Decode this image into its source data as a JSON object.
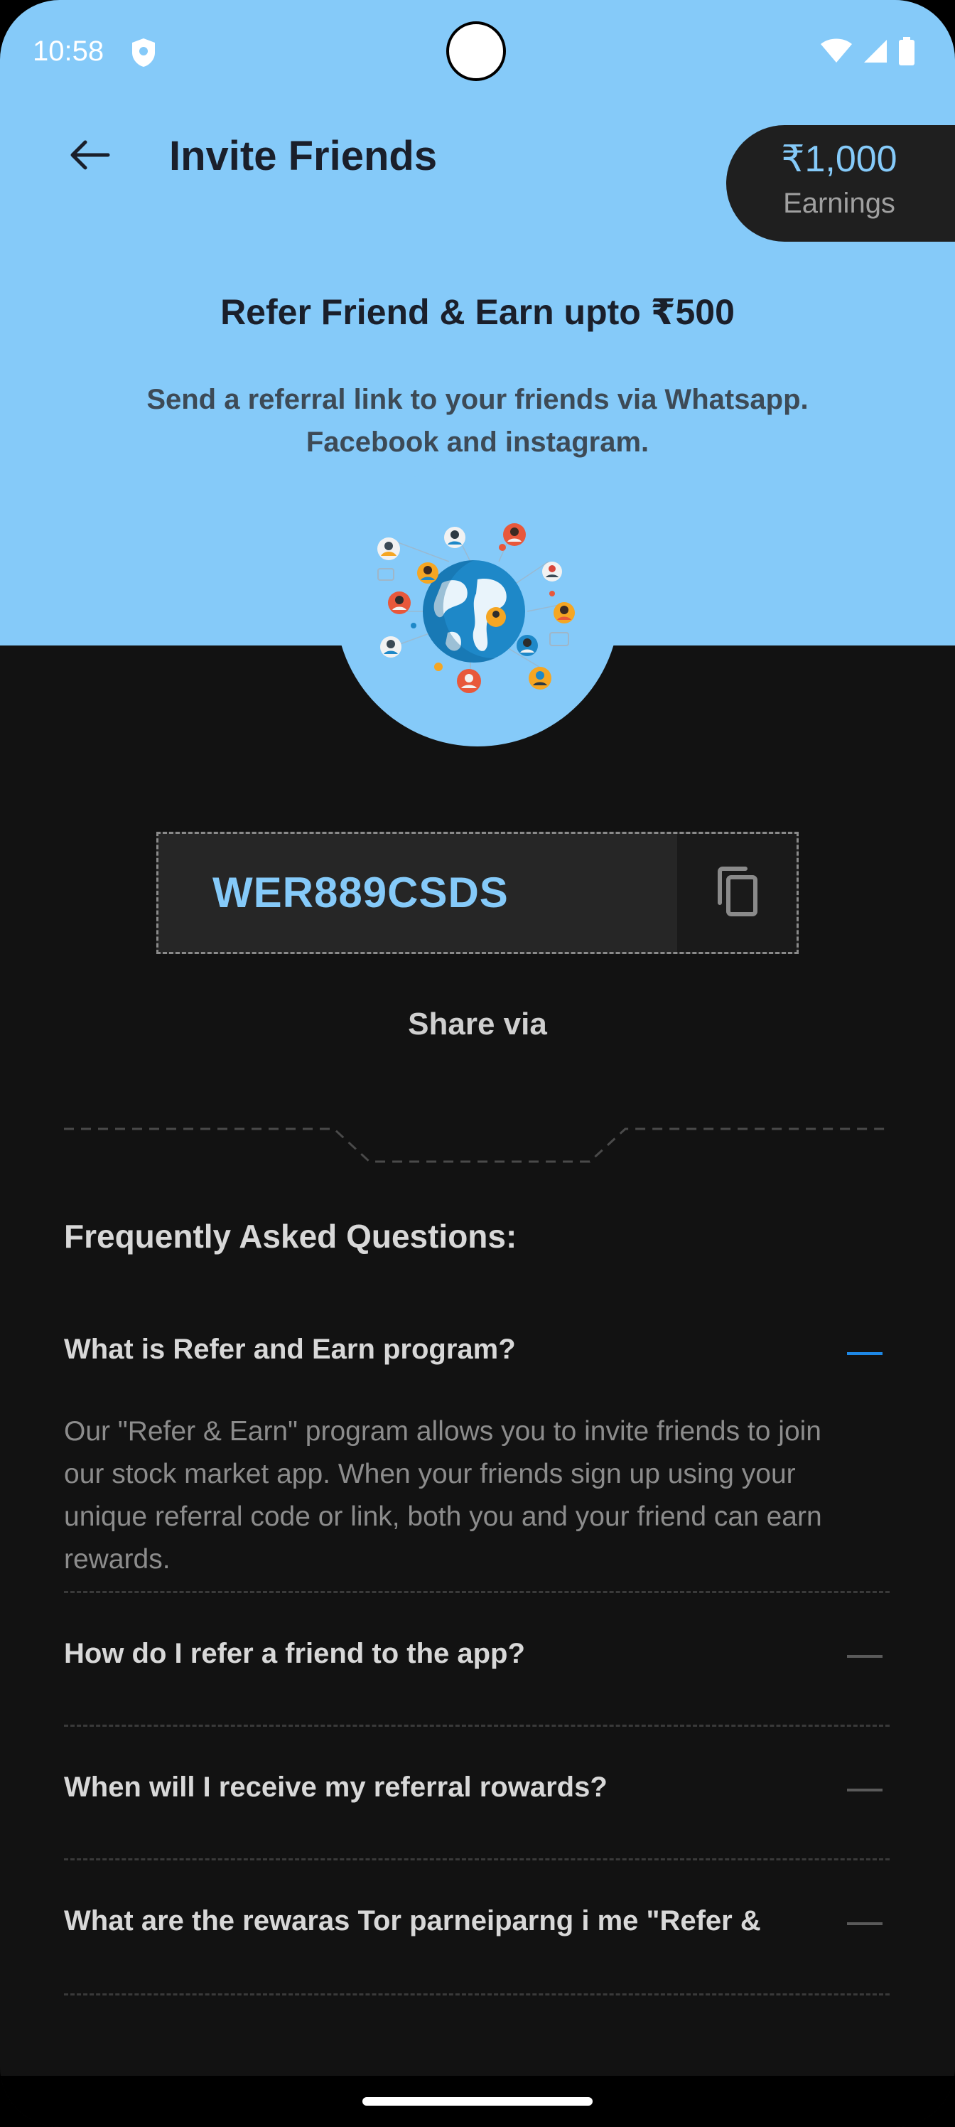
{
  "status_bar": {
    "time": "10:58"
  },
  "header": {
    "title": "Invite Friends"
  },
  "earnings": {
    "amount": "₹1,000",
    "label": "Earnings"
  },
  "hero": {
    "headline": "Refer Friend & Earn upto ₹500",
    "subtext": "Send a referral link to your friends via Whatsapp. Facebook and instagram."
  },
  "referral": {
    "code": "WER889CSDS",
    "share_label": "Share via"
  },
  "faq": {
    "title": "Frequently Asked Questions:",
    "items": [
      {
        "question": "What is Refer and Earn program?",
        "answer": "Our \"Refer & Earn\" program allows you to invite friends to join our stock market app. When your friends sign up using your unique referral code or link, both you and your friend can earn rewards.",
        "expanded": true
      },
      {
        "question": "How do I refer a friend to the app?",
        "expanded": false
      },
      {
        "question": "When will I receive my referral rowards?",
        "expanded": false
      },
      {
        "question": "What are the rewaras Tor parneiparng i me \"Refer &",
        "expanded": false
      }
    ]
  },
  "colors": {
    "hero_bg": "#85CAF9",
    "accent": "#85CAF9",
    "active_toggle": "#1E88E5",
    "page_bg": "#121212"
  },
  "icons": [
    "shield-icon",
    "wifi-icon",
    "signal-icon",
    "battery-icon",
    "back-arrow-icon",
    "copy-icon",
    "globe-network-illustration"
  ]
}
